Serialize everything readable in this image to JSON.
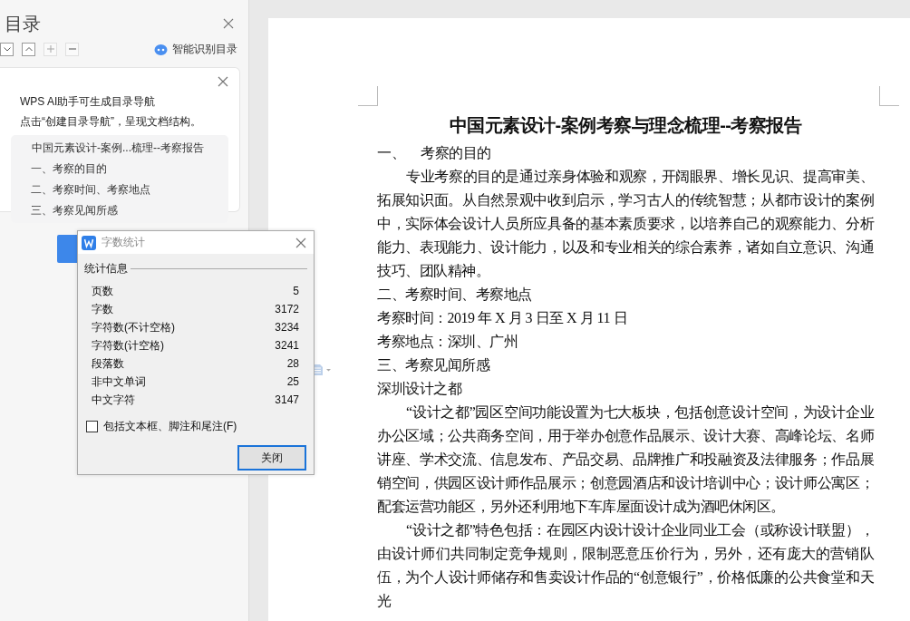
{
  "toc_panel": {
    "title": "目录",
    "tools": [
      {
        "kind": "down",
        "disabled": false
      },
      {
        "kind": "up",
        "disabled": false
      },
      {
        "kind": "plus",
        "disabled": true
      },
      {
        "kind": "minus",
        "disabled": true
      }
    ],
    "smart_button": "智能识别目录",
    "ai_card": {
      "line_1": "WPS AI助手可生成目录导航",
      "line_2": "点击“创建目录导航”，呈现文档结构。",
      "outline": [
        "中国元素设计-案例...梳理--考察报告",
        "一、考察的目的",
        "二、考察时间、考察地点",
        "三、考察见闻所感"
      ]
    }
  },
  "document": {
    "title": "中国元素设计-案例考察与理念梳理--考察报告",
    "blocks": [
      {
        "kind": "numbered",
        "number": "一、",
        "text": "考察的目的"
      },
      {
        "kind": "paragraph",
        "text": "专业考察的目的是通过亲身体验和观察，开阔眼界、增长见识、提高审美、拓展知识面。从自然景观中收到启示，学习古人的传统智慧；从都市设计的案例中，实际体会设计人员所应具备的基本素质要求，以培养自己的观察能力、分析能力、表现能力、设计能力，以及和专业相关的综合素养，诸如自立意识、沟通技巧、团队精神。"
      },
      {
        "kind": "line",
        "text": "二、考察时间、考察地点"
      },
      {
        "kind": "line",
        "text": "考察时间：2019 年 X 月 3 日至 X 月 11 日"
      },
      {
        "kind": "line",
        "text": "考察地点：深圳、广州"
      },
      {
        "kind": "line",
        "text": "三、考察见闻所感"
      },
      {
        "kind": "line",
        "text": "深圳设计之都"
      },
      {
        "kind": "paragraph",
        "text": "“设计之都”园区空间功能设置为七大板块，包括创意设计空间，为设计企业办公区域；公共商务空间，用于举办创意作品展示、设计大赛、高峰论坛、名师讲座、学术交流、信息发布、产品交易、品牌推广和投融资及法律服务；作品展销空间，供园区设计师作品展示；创意园酒店和设计培训中心；设计师公寓区；配套运营功能区，另外还利用地下车库屋面设计成为酒吧休闲区。"
      },
      {
        "kind": "paragraph",
        "text": "“设计之都”特色包括：在园区内设计设计企业同业工会（或称设计联盟），由设计师们共同制定竞争规则，限制恶意压价行为，另外，还有庞大的营销队伍，为个人设计师储存和售卖设计作品的“创意银行”，价格低廉的公共食堂和天光"
      }
    ]
  },
  "dialog": {
    "title": "字数统计",
    "group": "统计信息",
    "stats": [
      {
        "label": "页数",
        "value": "5"
      },
      {
        "label": "字数",
        "value": "3172"
      },
      {
        "label": "字符数(不计空格)",
        "value": "3234"
      },
      {
        "label": "字符数(计空格)",
        "value": "3241"
      },
      {
        "label": "段落数",
        "value": "28"
      },
      {
        "label": "非中文单词",
        "value": "25"
      },
      {
        "label": "中文字符",
        "value": "3147"
      }
    ],
    "checkbox": {
      "label": "包括文本框、脚注和尾注(F)",
      "checked": false
    },
    "close_button": "关闭"
  }
}
